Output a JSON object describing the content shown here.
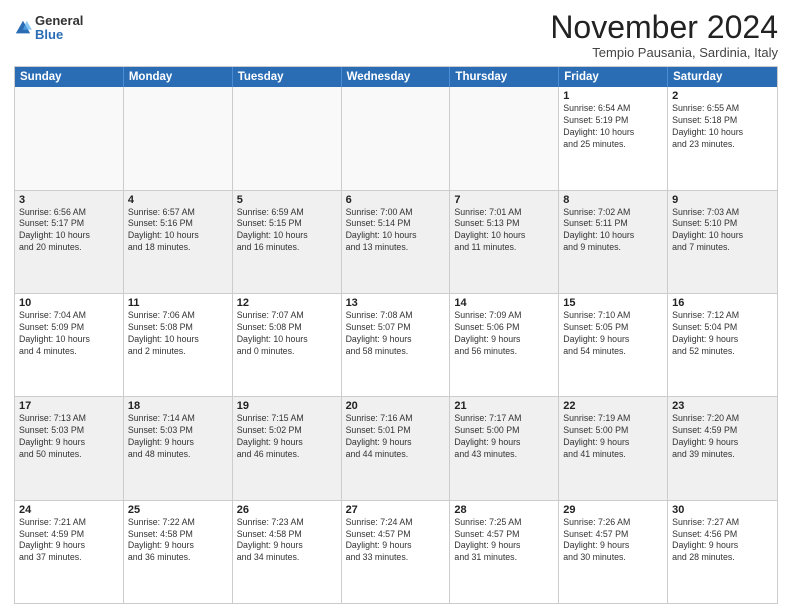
{
  "logo": {
    "general": "General",
    "blue": "Blue"
  },
  "header": {
    "month": "November 2024",
    "location": "Tempio Pausania, Sardinia, Italy"
  },
  "days": [
    "Sunday",
    "Monday",
    "Tuesday",
    "Wednesday",
    "Thursday",
    "Friday",
    "Saturday"
  ],
  "rows": [
    [
      {
        "day": "",
        "text": ""
      },
      {
        "day": "",
        "text": ""
      },
      {
        "day": "",
        "text": ""
      },
      {
        "day": "",
        "text": ""
      },
      {
        "day": "",
        "text": ""
      },
      {
        "day": "1",
        "text": "Sunrise: 6:54 AM\nSunset: 5:19 PM\nDaylight: 10 hours\nand 25 minutes."
      },
      {
        "day": "2",
        "text": "Sunrise: 6:55 AM\nSunset: 5:18 PM\nDaylight: 10 hours\nand 23 minutes."
      }
    ],
    [
      {
        "day": "3",
        "text": "Sunrise: 6:56 AM\nSunset: 5:17 PM\nDaylight: 10 hours\nand 20 minutes."
      },
      {
        "day": "4",
        "text": "Sunrise: 6:57 AM\nSunset: 5:16 PM\nDaylight: 10 hours\nand 18 minutes."
      },
      {
        "day": "5",
        "text": "Sunrise: 6:59 AM\nSunset: 5:15 PM\nDaylight: 10 hours\nand 16 minutes."
      },
      {
        "day": "6",
        "text": "Sunrise: 7:00 AM\nSunset: 5:14 PM\nDaylight: 10 hours\nand 13 minutes."
      },
      {
        "day": "7",
        "text": "Sunrise: 7:01 AM\nSunset: 5:13 PM\nDaylight: 10 hours\nand 11 minutes."
      },
      {
        "day": "8",
        "text": "Sunrise: 7:02 AM\nSunset: 5:11 PM\nDaylight: 10 hours\nand 9 minutes."
      },
      {
        "day": "9",
        "text": "Sunrise: 7:03 AM\nSunset: 5:10 PM\nDaylight: 10 hours\nand 7 minutes."
      }
    ],
    [
      {
        "day": "10",
        "text": "Sunrise: 7:04 AM\nSunset: 5:09 PM\nDaylight: 10 hours\nand 4 minutes."
      },
      {
        "day": "11",
        "text": "Sunrise: 7:06 AM\nSunset: 5:08 PM\nDaylight: 10 hours\nand 2 minutes."
      },
      {
        "day": "12",
        "text": "Sunrise: 7:07 AM\nSunset: 5:08 PM\nDaylight: 10 hours\nand 0 minutes."
      },
      {
        "day": "13",
        "text": "Sunrise: 7:08 AM\nSunset: 5:07 PM\nDaylight: 9 hours\nand 58 minutes."
      },
      {
        "day": "14",
        "text": "Sunrise: 7:09 AM\nSunset: 5:06 PM\nDaylight: 9 hours\nand 56 minutes."
      },
      {
        "day": "15",
        "text": "Sunrise: 7:10 AM\nSunset: 5:05 PM\nDaylight: 9 hours\nand 54 minutes."
      },
      {
        "day": "16",
        "text": "Sunrise: 7:12 AM\nSunset: 5:04 PM\nDaylight: 9 hours\nand 52 minutes."
      }
    ],
    [
      {
        "day": "17",
        "text": "Sunrise: 7:13 AM\nSunset: 5:03 PM\nDaylight: 9 hours\nand 50 minutes."
      },
      {
        "day": "18",
        "text": "Sunrise: 7:14 AM\nSunset: 5:03 PM\nDaylight: 9 hours\nand 48 minutes."
      },
      {
        "day": "19",
        "text": "Sunrise: 7:15 AM\nSunset: 5:02 PM\nDaylight: 9 hours\nand 46 minutes."
      },
      {
        "day": "20",
        "text": "Sunrise: 7:16 AM\nSunset: 5:01 PM\nDaylight: 9 hours\nand 44 minutes."
      },
      {
        "day": "21",
        "text": "Sunrise: 7:17 AM\nSunset: 5:00 PM\nDaylight: 9 hours\nand 43 minutes."
      },
      {
        "day": "22",
        "text": "Sunrise: 7:19 AM\nSunset: 5:00 PM\nDaylight: 9 hours\nand 41 minutes."
      },
      {
        "day": "23",
        "text": "Sunrise: 7:20 AM\nSunset: 4:59 PM\nDaylight: 9 hours\nand 39 minutes."
      }
    ],
    [
      {
        "day": "24",
        "text": "Sunrise: 7:21 AM\nSunset: 4:59 PM\nDaylight: 9 hours\nand 37 minutes."
      },
      {
        "day": "25",
        "text": "Sunrise: 7:22 AM\nSunset: 4:58 PM\nDaylight: 9 hours\nand 36 minutes."
      },
      {
        "day": "26",
        "text": "Sunrise: 7:23 AM\nSunset: 4:58 PM\nDaylight: 9 hours\nand 34 minutes."
      },
      {
        "day": "27",
        "text": "Sunrise: 7:24 AM\nSunset: 4:57 PM\nDaylight: 9 hours\nand 33 minutes."
      },
      {
        "day": "28",
        "text": "Sunrise: 7:25 AM\nSunset: 4:57 PM\nDaylight: 9 hours\nand 31 minutes."
      },
      {
        "day": "29",
        "text": "Sunrise: 7:26 AM\nSunset: 4:57 PM\nDaylight: 9 hours\nand 30 minutes."
      },
      {
        "day": "30",
        "text": "Sunrise: 7:27 AM\nSunset: 4:56 PM\nDaylight: 9 hours\nand 28 minutes."
      }
    ]
  ]
}
